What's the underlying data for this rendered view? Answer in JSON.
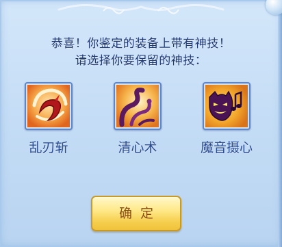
{
  "dialog": {
    "message_line1": "恭喜！你鉴定的装备上带有神技！",
    "message_line2": "请选择你要保留的神技："
  },
  "skills": [
    {
      "name": "乱刃斩",
      "icon": "swirling-blade-icon"
    },
    {
      "name": "清心术",
      "icon": "purple-tendril-icon"
    },
    {
      "name": "魔音摄心",
      "icon": "demon-music-icon"
    }
  ],
  "confirm_button": {
    "label": "确定"
  },
  "colors": {
    "panel_background": "#c5ddf6",
    "text": "#213a73",
    "button_gold": "#f6cf4e"
  }
}
